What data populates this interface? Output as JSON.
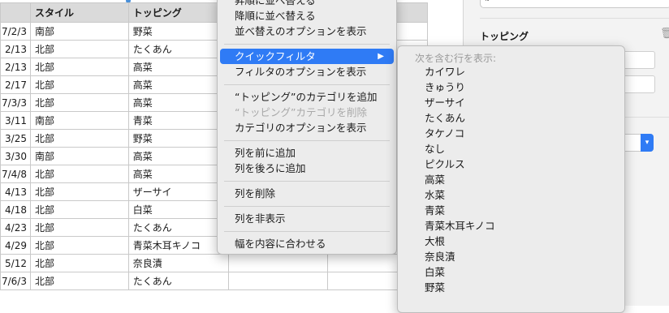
{
  "sheet": {
    "headers": [
      "",
      "スタイル",
      "トッピング",
      "",
      ""
    ],
    "rows": [
      {
        "date": "7/2/3",
        "style": "南部",
        "topping": "野菜"
      },
      {
        "date": "2/13",
        "style": "北部",
        "topping": "たくあん"
      },
      {
        "date": "2/13",
        "style": "北部",
        "topping": "高菜"
      },
      {
        "date": "2/17",
        "style": "北部",
        "topping": "高菜"
      },
      {
        "date": "7/3/3",
        "style": "北部",
        "topping": "高菜"
      },
      {
        "date": "3/11",
        "style": "南部",
        "topping": "青菜"
      },
      {
        "date": "3/25",
        "style": "北部",
        "topping": "野菜"
      },
      {
        "date": "3/30",
        "style": "南部",
        "topping": "高菜"
      },
      {
        "date": "7/4/8",
        "style": "北部",
        "topping": "高菜"
      },
      {
        "date": "4/13",
        "style": "北部",
        "topping": "ザーサイ"
      },
      {
        "date": "4/18",
        "style": "北部",
        "topping": "白菜"
      },
      {
        "date": "4/23",
        "style": "北部",
        "topping": "たくあん"
      },
      {
        "date": "4/29",
        "style": "北部",
        "topping": "青菜木耳キノコ"
      },
      {
        "date": "5/12",
        "style": "北部",
        "topping": "奈良漬"
      },
      {
        "date": "7/6/3",
        "style": "北部",
        "topping": "たくあん"
      }
    ]
  },
  "panel": {
    "topping_label": "トッピング"
  },
  "main_menu": {
    "items": [
      {
        "label": "昇順に並べ替える",
        "disabled": false
      },
      {
        "label": "降順に並べ替える",
        "disabled": false
      },
      {
        "label": "並べ替えのオプションを表示",
        "disabled": false
      },
      {
        "label": "クイックフィルタ",
        "disabled": false,
        "highlighted": true
      },
      {
        "label": "フィルタのオプションを表示",
        "disabled": false
      },
      {
        "label": "“トッピング”のカテゴリを追加",
        "disabled": false
      },
      {
        "label": "“トッピング”カテゴリを削除",
        "disabled": true
      },
      {
        "label": "カテゴリのオプションを表示",
        "disabled": false
      },
      {
        "label": "列を前に追加",
        "disabled": false
      },
      {
        "label": "列を後ろに追加",
        "disabled": false
      },
      {
        "label": "列を削除",
        "disabled": false
      },
      {
        "label": "列を非表示",
        "disabled": false
      },
      {
        "label": "幅を内容に合わせる",
        "disabled": false
      }
    ]
  },
  "quick_filter": {
    "header": "次を含む行を表示:",
    "items": [
      "カイワレ",
      "きゅうり",
      "ザーサイ",
      "たくあん",
      "タケノコ",
      "なし",
      "ピクルス",
      "高菜",
      "水菜",
      "青菜",
      "青菜木耳キノコ",
      "大根",
      "奈良漬",
      "白菜",
      "野菜"
    ]
  },
  "colors": {
    "highlight": "#2f7bf5",
    "header_bg": "#dadada",
    "menu_bg": "#ececec"
  }
}
